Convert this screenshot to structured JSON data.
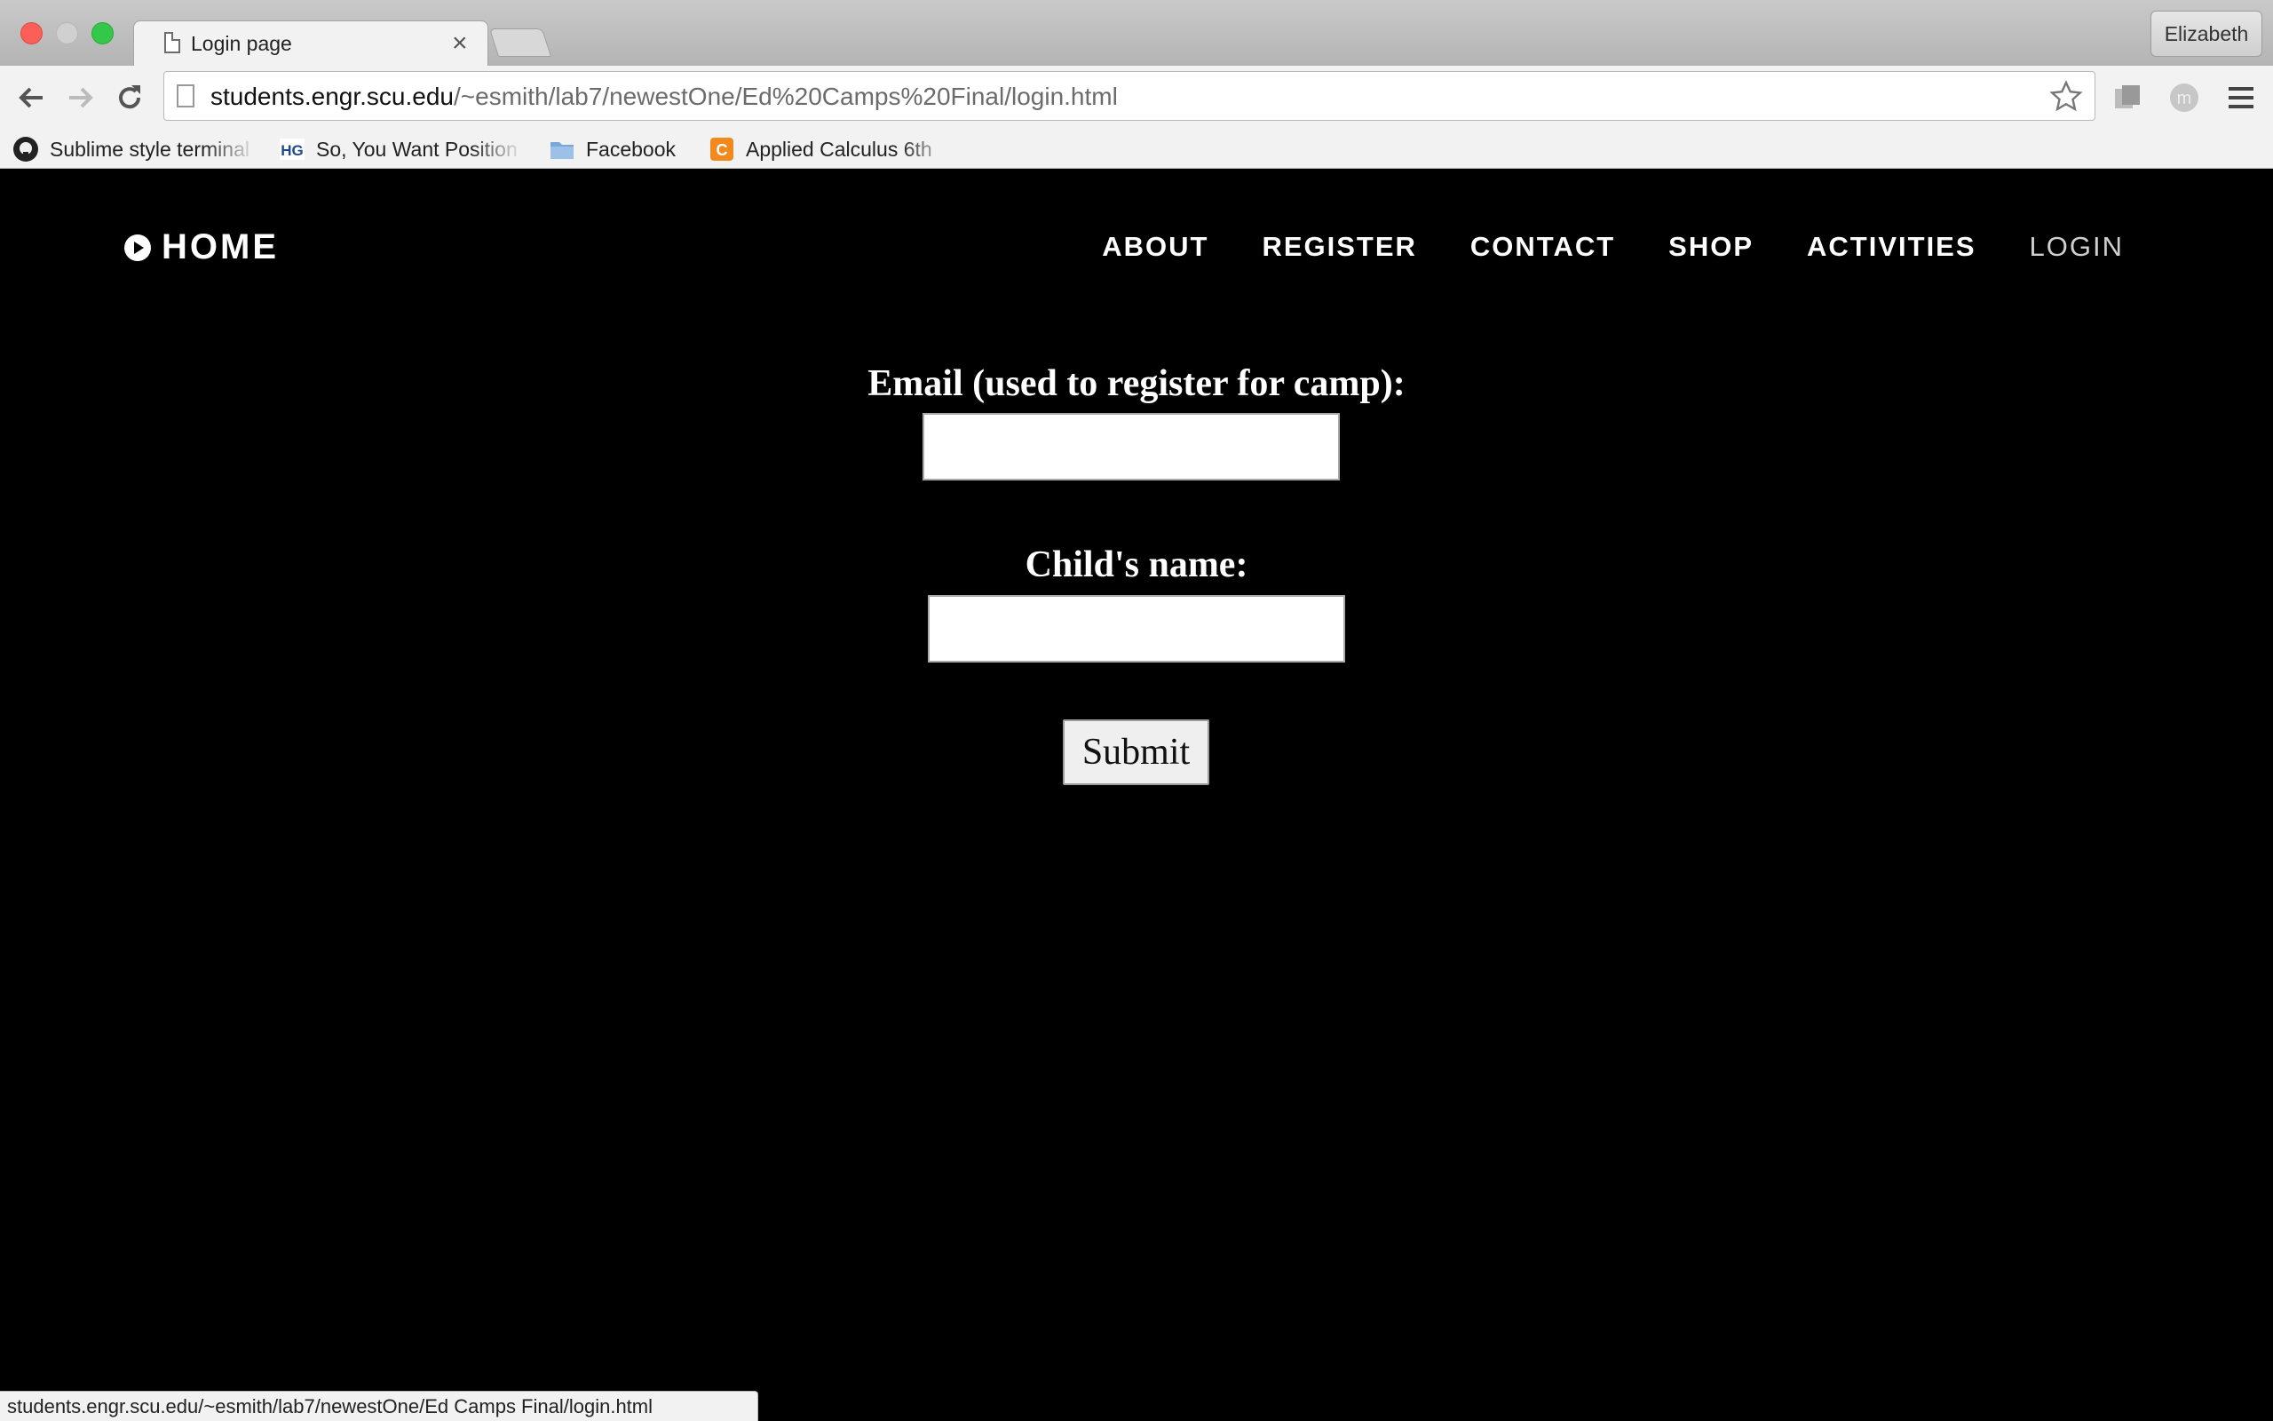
{
  "browser": {
    "tab_title": "Login page",
    "tab_close": "×",
    "profile_name": "Elizabeth",
    "url_host": "students.engr.scu.edu",
    "url_path": "/~esmith/lab7/newestOne/Ed%20Camps%20Final/login.html",
    "bookmarks": [
      {
        "label": "Sublime style terminal",
        "icon": "github-icon"
      },
      {
        "label": "So, You Want Position",
        "icon": "hg-icon"
      },
      {
        "label": "Facebook",
        "icon": "folder-icon"
      },
      {
        "label": "Applied Calculus 6th",
        "icon": "c-icon"
      }
    ],
    "status_url": "students.engr.scu.edu/~esmith/lab7/newestOne/Ed Camps Final/login.html"
  },
  "site": {
    "home_label": "HOME",
    "nav": [
      "ABOUT",
      "REGISTER",
      "CONTACT",
      "SHOP",
      "ACTIVITIES",
      "LOGIN"
    ],
    "current_nav": "LOGIN"
  },
  "form": {
    "email_label": "Email (used to register for camp):",
    "email_value": "",
    "child_label": "Child's name:",
    "child_value": "",
    "submit_label": "Submit"
  },
  "colors": {
    "page_bg": "#000000",
    "text": "#ffffff",
    "close": "#fc5f57",
    "maximize": "#34c84a"
  }
}
